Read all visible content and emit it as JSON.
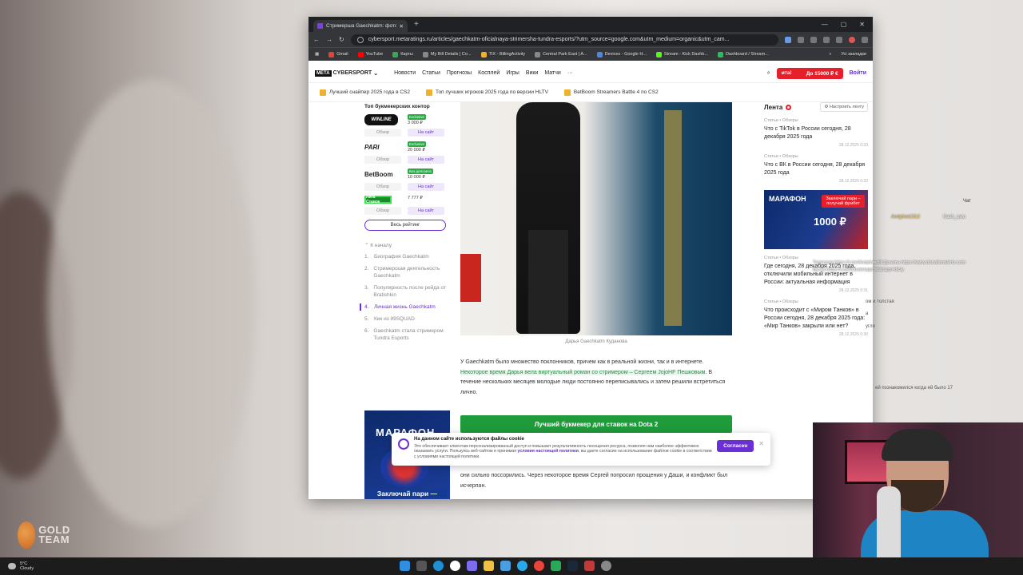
{
  "background": {
    "logo_text": "GOLD TEAM"
  },
  "browser": {
    "tab_title": "Стримерша Gaechkatm: фото,",
    "tab_new": "+",
    "window_controls": [
      "—",
      "▢",
      "✕"
    ],
    "url": "cybersport.metaratings.ru/articles/gaechkatm-oficialnaya-strimersha-tundra-esports/?utm_source=google.com&utm_medium=organic&utm_cam...",
    "bookmarks": [
      "Gmail",
      "YouTube",
      "Карты",
      "My Bill Details | Co...",
      "TIX - BillingActivity",
      "Central Park East | A...",
      "Devices - Google H...",
      "Stream - Kick Dashb...",
      "Dashboard / Stream..."
    ],
    "bookmarks_all": "Усі закладки"
  },
  "site": {
    "brand_meta": "META",
    "brand_name": "CYBERSPORT",
    "nav": [
      "Новости",
      "Статьи",
      "Прогнозы",
      "Косплей",
      "Игры",
      "Вики",
      "Матчи",
      "···"
    ],
    "promo_left": "ита!",
    "promo_right": "До 15000 ₽ €",
    "login": "Войти",
    "subbar": [
      "Лучший снайпер 2025 года в CS2",
      "Топ лучших игроков 2025 года по версии HLTV",
      "BetBoom Streamers Battle 4 по CS2"
    ]
  },
  "bookmakers": {
    "title": "Топ букмекерских контор",
    "items": [
      {
        "name": "WINLINE",
        "tag": "Exclusive",
        "bonus": "3 000 ₽",
        "review": "Обзор",
        "go": "На сайт"
      },
      {
        "name": "PARI",
        "tag": "Exclusive",
        "bonus": "20 000 ₽",
        "review": "Обзор",
        "go": "На сайт"
      },
      {
        "name": "BetBoom",
        "tag": "Без депозита",
        "bonus": "10 000 ₽",
        "review": "Обзор",
        "go": "На сайт"
      },
      {
        "name": "Лига Ставок",
        "tag": "",
        "bonus": "7 777 ₽",
        "review": "Обзор",
        "go": "На сайт"
      }
    ],
    "all_rating": "Весь рейтинг"
  },
  "toc": {
    "top": "К началу",
    "items": [
      {
        "n": "1.",
        "t": "Биография Gaechkatm"
      },
      {
        "n": "2.",
        "t": "Стримерская деятельность Gaechkatm"
      },
      {
        "n": "3.",
        "t": "Популярность после рейда от Bratishkin"
      },
      {
        "n": "4.",
        "t": "Личная жизнь Gaechkatm"
      },
      {
        "n": "5.",
        "t": "Кик из 89SQUAD"
      },
      {
        "n": "6.",
        "t": "Gaechkatm стала стримером Tundra Esports"
      }
    ]
  },
  "ad_left": {
    "title": "МАРАФОН",
    "cta": "Заключай пари —"
  },
  "article": {
    "caption": "Дарья Gaechkatm Куданова",
    "para_a": "У Gaechkatm было множество поклонников, причем как в реальной жизни, так и в интернете. ",
    "para_hl": "Некоторое время Дарья вела виртуальный роман со стримером – Сергеем JojoHF Пешковым",
    "para_b": ". В течение нескольких месяцев молодые люди постоянно переписывались и затем решили встретиться лично.",
    "green_button": "Лучший букмекер для ставок на Dota 2",
    "para2": "они сильно поссорились. Через некоторое время Сергей попросил прощения у Даши, и конфликт был исчерпан."
  },
  "cookie": {
    "title": "На данном сайте используются файлы cookie",
    "text_a": "Это обеспечивает клиентам персонализированный доступ и повышает результативность посещения ресурса, позволяя нам наиболее эффективно оказывать услуги. Пользуясь веб-сайтом и принимая ",
    "link": "условия настоящей политики",
    "text_b": ", вы даете согласие на использование файлов cookie в соответствии с условиями настоящей политики.",
    "agree": "Согласен",
    "close": "✕"
  },
  "feed": {
    "title": "Лента",
    "settings": "Настроить ленту",
    "items": [
      {
        "cat": "Статьи • Обзоры",
        "title": "Что с TikTok в России сегодня, 28 декабря 2025 года",
        "date": "28.12.2025 0:33"
      },
      {
        "cat": "Статьи • Обзоры",
        "title": "Что с ВК в России сегодня, 28 декабря 2025 года",
        "date": "28.12.2025 0:32"
      },
      {
        "cat": "Статьи • Обзоры",
        "title": "Где сегодня, 28 декабря 2025 года, отключили мобильный интернет в России: актуальная информация",
        "date": "28.12.2025 0:31"
      },
      {
        "cat": "Статьи • Обзоры",
        "title": "Что происходит с «Миром Танков» в России сегодня, 28 декабря 2025 года: «Мир Танков» закрыли или нет?",
        "date": "28.12.2025 0:30"
      }
    ],
    "ad": {
      "a": "МАРАФОН",
      "b": "Заключай пари – получай фрибет",
      "c": "1000 ₽"
    }
  },
  "chat": {
    "header": "Чат",
    "lines": [
      "Andylive1312",
      "Kash_owo",
      "Телеграм https://t.me/Andyliveclill Донаты https://www.donationalerts.com",
      "Бусти https://t.me/tribute/app?startapp=dkJy",
      "ом и толстая",
      "а",
      "угли",
      "ей познакомился когда ей было 17"
    ]
  },
  "taskbar": {
    "temp": "5°C",
    "cond": "Cloudy"
  }
}
